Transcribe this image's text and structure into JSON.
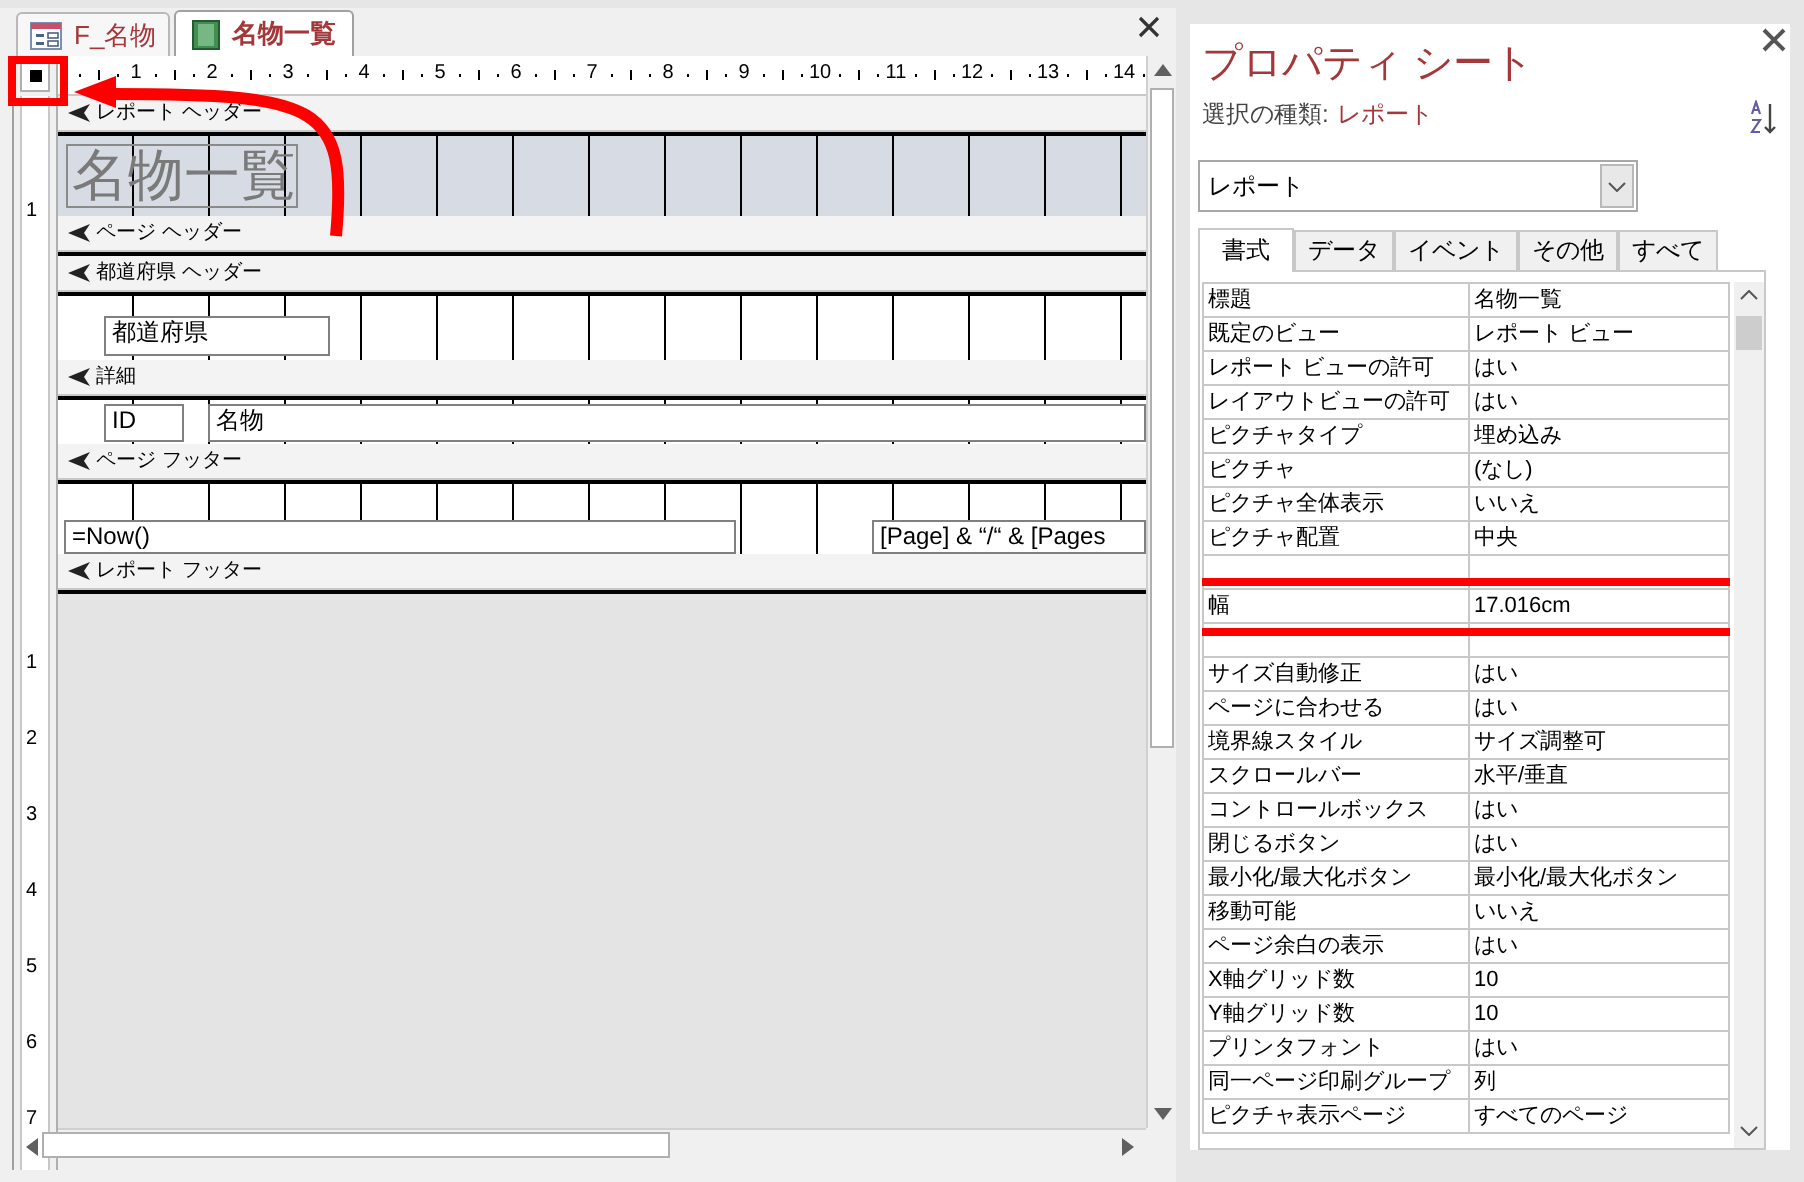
{
  "document_tabs": [
    {
      "label": "F_名物",
      "kind": "form",
      "selected": false
    },
    {
      "label": "名物一覧",
      "kind": "report",
      "selected": true
    }
  ],
  "ruler_corner": {
    "highlighted": true
  },
  "horizontal_ruler": [
    "1",
    "2",
    "3",
    "4",
    "5",
    "6",
    "7",
    "8",
    "9",
    "10",
    "11",
    "12",
    "13",
    "14"
  ],
  "vertical_ruler": [
    "1",
    "1",
    "2",
    "3",
    "4",
    "5",
    "6",
    "7"
  ],
  "sections": [
    {
      "kind": "report-header",
      "title": "レポート ヘッダー",
      "controls": [
        {
          "kind": "title-label",
          "text": "名物一覧"
        }
      ]
    },
    {
      "kind": "page-header",
      "title": "ページ ヘッダー"
    },
    {
      "kind": "group-header",
      "title": "都道府県 ヘッダー",
      "controls": [
        {
          "kind": "textbox",
          "text": "都道府県"
        }
      ]
    },
    {
      "kind": "detail",
      "title": "詳細",
      "controls": [
        {
          "kind": "textbox",
          "text": "ID"
        },
        {
          "kind": "textbox",
          "text": "名物"
        }
      ]
    },
    {
      "kind": "page-footer",
      "title": "ページ フッター",
      "controls": [
        {
          "kind": "textbox",
          "text": "=Now()"
        },
        {
          "kind": "textbox",
          "text": "[Page] & “/“ & [Pages"
        }
      ]
    },
    {
      "kind": "report-footer",
      "title": "レポート フッター"
    }
  ],
  "property_sheet": {
    "title": "プロパティ シート",
    "selection_label": "選択の種類:",
    "selection_type": "レポート",
    "object_dropdown": "レポート",
    "tabs": [
      {
        "label": "書式",
        "selected": true
      },
      {
        "label": "データ",
        "selected": false
      },
      {
        "label": "イベント",
        "selected": false
      },
      {
        "label": "その他",
        "selected": false
      },
      {
        "label": "すべて",
        "selected": false
      }
    ],
    "rows": [
      {
        "name": "標題",
        "value": "名物一覧",
        "highlighted": false
      },
      {
        "name": "既定のビュー",
        "value": "レポート ビュー",
        "highlighted": false
      },
      {
        "name": "レポート ビューの許可",
        "value": "はい",
        "highlighted": false
      },
      {
        "name": "レイアウトビューの許可",
        "value": "はい",
        "highlighted": false
      },
      {
        "name": "ピクチャタイプ",
        "value": "埋め込み",
        "highlighted": false
      },
      {
        "name": "ピクチャ",
        "value": "(なし)",
        "highlighted": false
      },
      {
        "name": "ピクチャ全体表示",
        "value": "いいえ",
        "highlighted": false
      },
      {
        "name": "ピクチャ配置",
        "value": "中央",
        "highlighted": false
      },
      {
        "name": "幅",
        "value": "17.016cm",
        "highlighted": true
      },
      {
        "name": "サイズ自動修正",
        "value": "はい",
        "highlighted": false
      },
      {
        "name": "ページに合わせる",
        "value": "はい",
        "highlighted": false
      },
      {
        "name": "境界線スタイル",
        "value": "サイズ調整可",
        "highlighted": false
      },
      {
        "name": "スクロールバー",
        "value": "水平/垂直",
        "highlighted": false
      },
      {
        "name": "コントロールボックス",
        "value": "はい",
        "highlighted": false
      },
      {
        "name": "閉じるボタン",
        "value": "はい",
        "highlighted": false
      },
      {
        "name": "最小化/最大化ボタン",
        "value": "最小化/最大化ボタン",
        "highlighted": false
      },
      {
        "name": "移動可能",
        "value": "いいえ",
        "highlighted": false
      },
      {
        "name": "ページ余白の表示",
        "value": "はい",
        "highlighted": false
      },
      {
        "name": "X軸グリッド数",
        "value": "10",
        "highlighted": false
      },
      {
        "name": "Y軸グリッド数",
        "value": "10",
        "highlighted": false
      },
      {
        "name": "プリンタフォント",
        "value": "はい",
        "highlighted": false
      },
      {
        "name": "同一ページ印刷グループ",
        "value": "列",
        "highlighted": false
      },
      {
        "name": "ピクチャ表示ページ",
        "value": "すべてのページ",
        "highlighted": false
      }
    ]
  }
}
